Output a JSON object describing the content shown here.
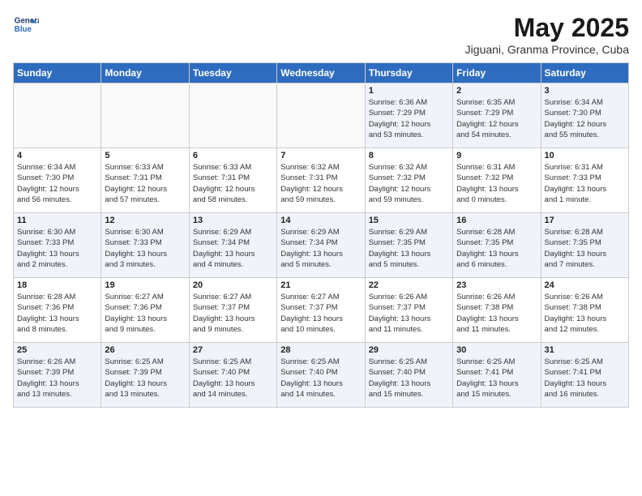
{
  "header": {
    "logo_line1": "General",
    "logo_line2": "Blue",
    "month": "May 2025",
    "location": "Jiguani, Granma Province, Cuba"
  },
  "days_of_week": [
    "Sunday",
    "Monday",
    "Tuesday",
    "Wednesday",
    "Thursday",
    "Friday",
    "Saturday"
  ],
  "weeks": [
    [
      {
        "num": "",
        "detail": ""
      },
      {
        "num": "",
        "detail": ""
      },
      {
        "num": "",
        "detail": ""
      },
      {
        "num": "",
        "detail": ""
      },
      {
        "num": "1",
        "detail": "Sunrise: 6:36 AM\nSunset: 7:29 PM\nDaylight: 12 hours\nand 53 minutes."
      },
      {
        "num": "2",
        "detail": "Sunrise: 6:35 AM\nSunset: 7:29 PM\nDaylight: 12 hours\nand 54 minutes."
      },
      {
        "num": "3",
        "detail": "Sunrise: 6:34 AM\nSunset: 7:30 PM\nDaylight: 12 hours\nand 55 minutes."
      }
    ],
    [
      {
        "num": "4",
        "detail": "Sunrise: 6:34 AM\nSunset: 7:30 PM\nDaylight: 12 hours\nand 56 minutes."
      },
      {
        "num": "5",
        "detail": "Sunrise: 6:33 AM\nSunset: 7:31 PM\nDaylight: 12 hours\nand 57 minutes."
      },
      {
        "num": "6",
        "detail": "Sunrise: 6:33 AM\nSunset: 7:31 PM\nDaylight: 12 hours\nand 58 minutes."
      },
      {
        "num": "7",
        "detail": "Sunrise: 6:32 AM\nSunset: 7:31 PM\nDaylight: 12 hours\nand 59 minutes."
      },
      {
        "num": "8",
        "detail": "Sunrise: 6:32 AM\nSunset: 7:32 PM\nDaylight: 12 hours\nand 59 minutes."
      },
      {
        "num": "9",
        "detail": "Sunrise: 6:31 AM\nSunset: 7:32 PM\nDaylight: 13 hours\nand 0 minutes."
      },
      {
        "num": "10",
        "detail": "Sunrise: 6:31 AM\nSunset: 7:33 PM\nDaylight: 13 hours\nand 1 minute."
      }
    ],
    [
      {
        "num": "11",
        "detail": "Sunrise: 6:30 AM\nSunset: 7:33 PM\nDaylight: 13 hours\nand 2 minutes."
      },
      {
        "num": "12",
        "detail": "Sunrise: 6:30 AM\nSunset: 7:33 PM\nDaylight: 13 hours\nand 3 minutes."
      },
      {
        "num": "13",
        "detail": "Sunrise: 6:29 AM\nSunset: 7:34 PM\nDaylight: 13 hours\nand 4 minutes."
      },
      {
        "num": "14",
        "detail": "Sunrise: 6:29 AM\nSunset: 7:34 PM\nDaylight: 13 hours\nand 5 minutes."
      },
      {
        "num": "15",
        "detail": "Sunrise: 6:29 AM\nSunset: 7:35 PM\nDaylight: 13 hours\nand 5 minutes."
      },
      {
        "num": "16",
        "detail": "Sunrise: 6:28 AM\nSunset: 7:35 PM\nDaylight: 13 hours\nand 6 minutes."
      },
      {
        "num": "17",
        "detail": "Sunrise: 6:28 AM\nSunset: 7:35 PM\nDaylight: 13 hours\nand 7 minutes."
      }
    ],
    [
      {
        "num": "18",
        "detail": "Sunrise: 6:28 AM\nSunset: 7:36 PM\nDaylight: 13 hours\nand 8 minutes."
      },
      {
        "num": "19",
        "detail": "Sunrise: 6:27 AM\nSunset: 7:36 PM\nDaylight: 13 hours\nand 9 minutes."
      },
      {
        "num": "20",
        "detail": "Sunrise: 6:27 AM\nSunset: 7:37 PM\nDaylight: 13 hours\nand 9 minutes."
      },
      {
        "num": "21",
        "detail": "Sunrise: 6:27 AM\nSunset: 7:37 PM\nDaylight: 13 hours\nand 10 minutes."
      },
      {
        "num": "22",
        "detail": "Sunrise: 6:26 AM\nSunset: 7:37 PM\nDaylight: 13 hours\nand 11 minutes."
      },
      {
        "num": "23",
        "detail": "Sunrise: 6:26 AM\nSunset: 7:38 PM\nDaylight: 13 hours\nand 11 minutes."
      },
      {
        "num": "24",
        "detail": "Sunrise: 6:26 AM\nSunset: 7:38 PM\nDaylight: 13 hours\nand 12 minutes."
      }
    ],
    [
      {
        "num": "25",
        "detail": "Sunrise: 6:26 AM\nSunset: 7:39 PM\nDaylight: 13 hours\nand 13 minutes."
      },
      {
        "num": "26",
        "detail": "Sunrise: 6:25 AM\nSunset: 7:39 PM\nDaylight: 13 hours\nand 13 minutes."
      },
      {
        "num": "27",
        "detail": "Sunrise: 6:25 AM\nSunset: 7:40 PM\nDaylight: 13 hours\nand 14 minutes."
      },
      {
        "num": "28",
        "detail": "Sunrise: 6:25 AM\nSunset: 7:40 PM\nDaylight: 13 hours\nand 14 minutes."
      },
      {
        "num": "29",
        "detail": "Sunrise: 6:25 AM\nSunset: 7:40 PM\nDaylight: 13 hours\nand 15 minutes."
      },
      {
        "num": "30",
        "detail": "Sunrise: 6:25 AM\nSunset: 7:41 PM\nDaylight: 13 hours\nand 15 minutes."
      },
      {
        "num": "31",
        "detail": "Sunrise: 6:25 AM\nSunset: 7:41 PM\nDaylight: 13 hours\nand 16 minutes."
      }
    ]
  ]
}
